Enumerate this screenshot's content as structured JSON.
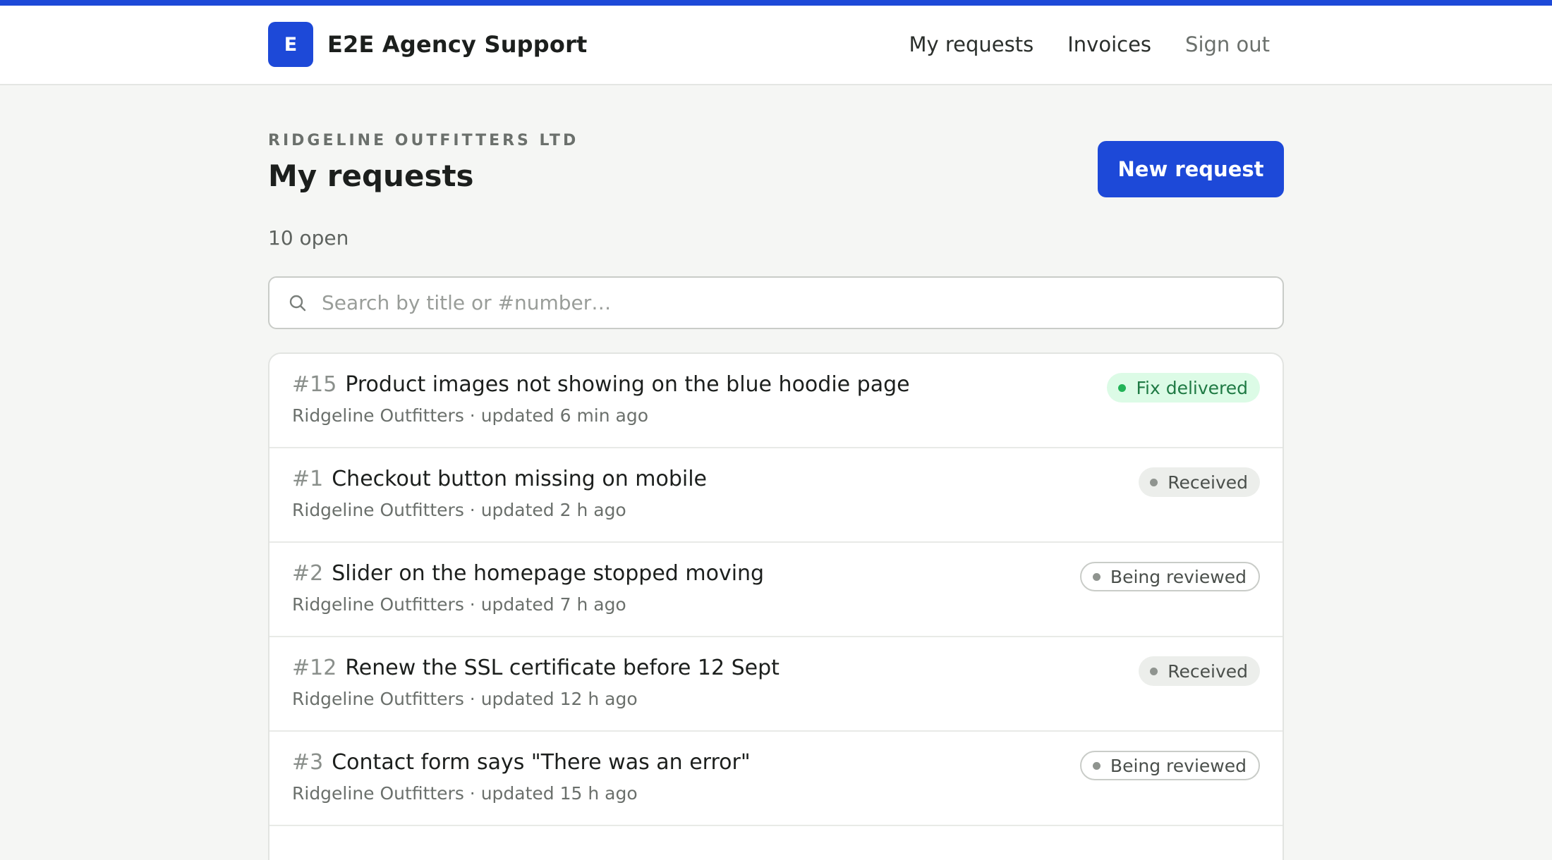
{
  "header": {
    "logo_letter": "E",
    "brand_name": "E2E Agency Support",
    "nav": {
      "my_requests": "My requests",
      "invoices": "Invoices",
      "sign_out": "Sign out"
    }
  },
  "page": {
    "org_name": "RIDGELINE OUTFITTERS LTD",
    "title": "My requests",
    "new_request_label": "New request",
    "open_count": "10 open"
  },
  "search": {
    "placeholder": "Search by title or #number…",
    "value": ""
  },
  "requests": [
    {
      "number": "#15",
      "title": "Product images not showing on the blue hoodie page",
      "meta": "Ridgeline Outfitters · updated 6 min ago",
      "status": "Fix delivered"
    },
    {
      "number": "#1",
      "title": "Checkout button missing on mobile",
      "meta": "Ridgeline Outfitters · updated 2 h ago",
      "status": "Received"
    },
    {
      "number": "#2",
      "title": "Slider on the homepage stopped moving",
      "meta": "Ridgeline Outfitters · updated 7 h ago",
      "status": "Being reviewed"
    },
    {
      "number": "#12",
      "title": "Renew the SSL certificate before 12 Sept",
      "meta": "Ridgeline Outfitters · updated 12 h ago",
      "status": "Received"
    },
    {
      "number": "#3",
      "title": "Contact form says \"There was an error\"",
      "meta": "Ridgeline Outfitters · updated 15 h ago",
      "status": "Being reviewed"
    }
  ],
  "colors": {
    "accent": "#1d49d8",
    "status_delivered": "#22b357",
    "status_neutral": "#8f948f"
  }
}
